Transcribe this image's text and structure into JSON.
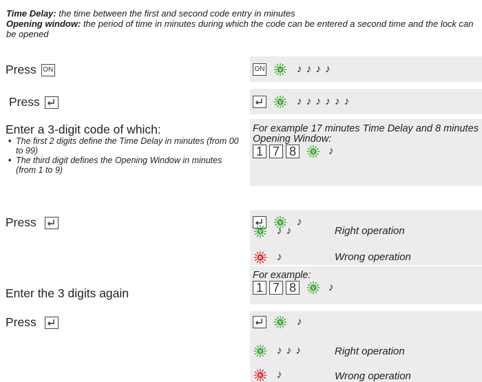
{
  "intro": {
    "term1": "Time Delay:",
    "def1": " the time between the first and second code entry in minutes",
    "term2": "Opening window:",
    "def2": " the period of time in minutes during which the code can be entered a second time and the lock can be opened"
  },
  "steps": [
    {
      "action": "Press",
      "key": "ON"
    },
    {
      "action": "Press",
      "key": "enter"
    },
    {
      "action": "Enter a 3-digit code of which:",
      "bullets": [
        "The first 2 digits define the Time Delay in minutes (from 00 to 99)",
        "The third digit defines the Opening Window in minutes (from 1 to 9)"
      ]
    },
    {
      "action": "Press",
      "key": "enter"
    },
    {
      "action": "Enter the 3 digits again"
    },
    {
      "action": "Press",
      "key": "enter"
    }
  ],
  "panel": {
    "on_key": "ON",
    "example1_line1": "For example 17 minutes Time Delay and 8 minutes",
    "example1_line2": "Opening Window:",
    "digits": [
      "1",
      "7",
      "8"
    ],
    "example2": "For example:",
    "right_operation": "Right operation",
    "wrong_operation": "Wrong operation",
    "led_green_letter": "V",
    "led_red_letter": "R"
  },
  "colors": {
    "panel_bg": "#ececec",
    "led_green": "#3aa635",
    "led_red": "#d8232a"
  },
  "icons": {
    "beep": "musical-note-icon",
    "led_green": "green-led-icon",
    "led_red": "red-led-icon",
    "enter": "enter-key-icon"
  }
}
